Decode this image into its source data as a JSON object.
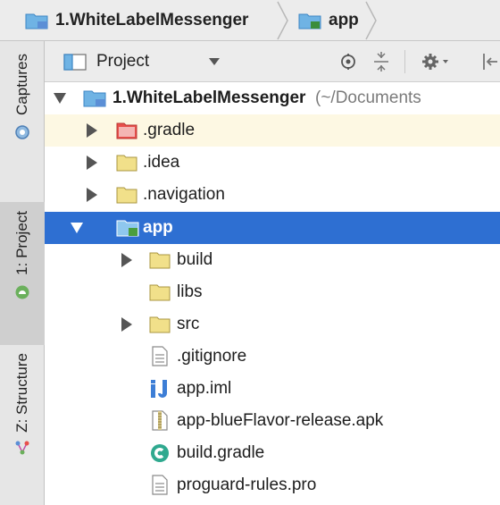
{
  "breadcrumb": {
    "items": [
      {
        "label": "1.WhiteLabelMessenger",
        "icon": "project-folder-icon"
      },
      {
        "label": "app",
        "icon": "module-folder-icon"
      }
    ]
  },
  "tool_strip": {
    "tabs": [
      {
        "label": "Captures",
        "icon": "captures-icon"
      },
      {
        "label": "1: Project",
        "icon": "android-icon",
        "active": true
      },
      {
        "label": "Z: Structure",
        "icon": "structure-icon"
      }
    ]
  },
  "project_toolbar": {
    "view_label": "Project",
    "icons": [
      "scroll-from-source-icon",
      "collapse-all-icon",
      "gear-icon",
      "hide-icon"
    ]
  },
  "tree": {
    "root": {
      "label": "1.WhiteLabelMessenger",
      "path": " (~/Documents"
    },
    "rows": [
      {
        "label": ".gradle"
      },
      {
        "label": ".idea"
      },
      {
        "label": ".navigation"
      },
      {
        "label": "app"
      },
      {
        "label": "build"
      },
      {
        "label": "libs"
      },
      {
        "label": "src"
      },
      {
        "label": ".gitignore"
      },
      {
        "label": "app.iml"
      },
      {
        "label": "app-blueFlavor-release.apk"
      },
      {
        "label": "build.gradle"
      },
      {
        "label": "proguard-rules.pro"
      }
    ]
  },
  "colors": {
    "selection": "#2e6fd2",
    "highlight_row": "#fdf8e3",
    "folder_blue": "#6fb3e4",
    "folder_red": "#e8504c",
    "folder_yellow": "#f1e08a"
  }
}
